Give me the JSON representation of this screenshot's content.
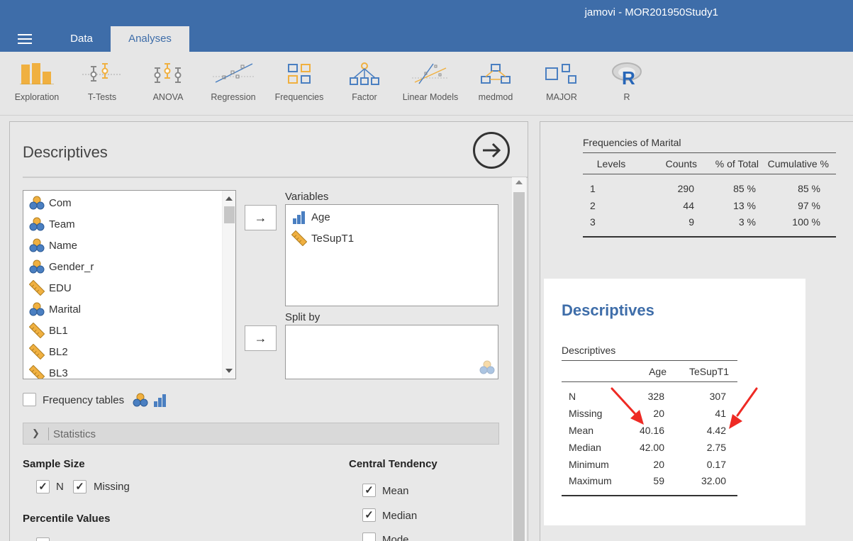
{
  "app": {
    "title": "jamovi - MOR201950Study1"
  },
  "tabs": [
    {
      "label": "Data"
    },
    {
      "label": "Analyses"
    }
  ],
  "ribbon": [
    {
      "label": "Exploration",
      "icon": "exploration-icon"
    },
    {
      "label": "T-Tests",
      "icon": "t-tests-icon"
    },
    {
      "label": "ANOVA",
      "icon": "anova-icon"
    },
    {
      "label": "Regression",
      "icon": "regression-icon"
    },
    {
      "label": "Frequencies",
      "icon": "frequencies-icon"
    },
    {
      "label": "Factor",
      "icon": "factor-icon"
    },
    {
      "label": "Linear Models",
      "icon": "linear-models-icon"
    },
    {
      "label": "medmod",
      "icon": "medmod-icon"
    },
    {
      "label": "MAJOR",
      "icon": "major-icon"
    },
    {
      "label": "R",
      "icon": "r-icon"
    }
  ],
  "panel": {
    "title": "Descriptives",
    "variables_list": [
      {
        "name": "Com",
        "type": "nominal"
      },
      {
        "name": "Team",
        "type": "nominal"
      },
      {
        "name": "Name",
        "type": "nominal"
      },
      {
        "name": "Gender_r",
        "type": "nominal"
      },
      {
        "name": "EDU",
        "type": "continuous"
      },
      {
        "name": "Marital",
        "type": "nominal"
      },
      {
        "name": "BL1",
        "type": "continuous"
      },
      {
        "name": "BL2",
        "type": "continuous"
      },
      {
        "name": "BL3",
        "type": "continuous"
      }
    ],
    "arrow_label": "→",
    "variables_label": "Variables",
    "selected_variables": [
      {
        "name": "Age",
        "type": "ordinal"
      },
      {
        "name": "TeSupT1",
        "type": "continuous"
      }
    ],
    "split_by_label": "Split by",
    "frequency_tables_label": "Frequency tables",
    "frequency_tables_checked": false,
    "statistics_label": "Statistics",
    "sample_size": {
      "heading": "Sample Size",
      "n_label": "N",
      "n_checked": true,
      "missing_label": "Missing",
      "missing_checked": true
    },
    "central_tendency": {
      "heading": "Central Tendency",
      "mean_label": "Mean",
      "mean_checked": true,
      "median_label": "Median",
      "median_checked": true,
      "mode_label": "Mode",
      "mode_checked": false
    },
    "percentile_heading": "Percentile Values",
    "checkmark": "✓"
  },
  "results": {
    "frequencies": {
      "title": "Frequencies of Marital",
      "columns": [
        "Levels",
        "Counts",
        "% of Total",
        "Cumulative %"
      ],
      "rows": [
        [
          "1",
          "290",
          "85 %",
          "85 %"
        ],
        [
          "2",
          "44",
          "13 %",
          "97 %"
        ],
        [
          "3",
          "9",
          "3 %",
          "100 %"
        ]
      ]
    },
    "descriptives": {
      "heading": "Descriptives",
      "table_title": "Descriptives",
      "columns": [
        "",
        "Age",
        "TeSupT1"
      ],
      "rows": [
        [
          "N",
          "328",
          "307"
        ],
        [
          "Missing",
          "20",
          "41"
        ],
        [
          "Mean",
          "40.16",
          "4.42"
        ],
        [
          "Median",
          "42.00",
          "2.75"
        ],
        [
          "Minimum",
          "20",
          "0.17"
        ],
        [
          "Maximum",
          "59",
          "32.00"
        ]
      ]
    },
    "annotation_color": "#ee2a24"
  }
}
